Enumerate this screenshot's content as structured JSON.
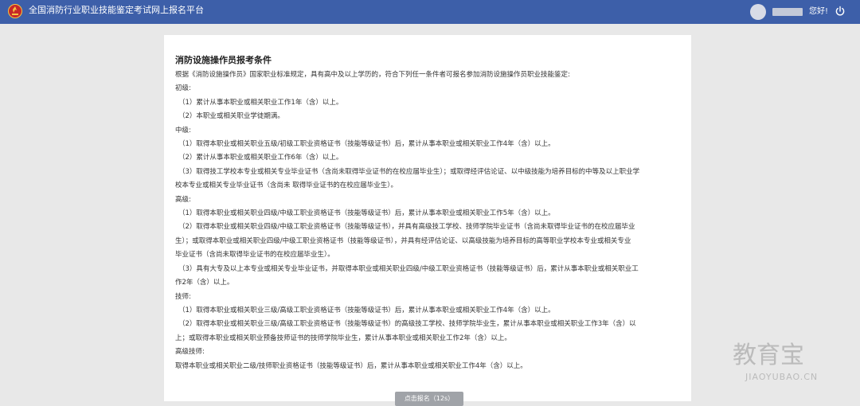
{
  "header": {
    "title": "全国消防行业职业技能鉴定考试网上报名平台",
    "greeting": "您好!",
    "logo_icon": "fire-emblem-icon",
    "power_icon": "power-icon"
  },
  "article": {
    "title": "消防设施操作员报考条件",
    "intro": "根据《消防设施操作员》国家职业标准规定，具有高中及以上学历的，符合下列任一条件者可报名参加消防设施操作员职业技能鉴定:",
    "lines": [
      {
        "text": "初级:",
        "indent": false
      },
      {
        "text": "（1）累计从事本职业或相关职业工作1年（含）以上。",
        "indent": true
      },
      {
        "text": "（2）本职业或相关职业学徒期满。",
        "indent": true
      },
      {
        "text": "中级:",
        "indent": false
      },
      {
        "text": "（1）取得本职业或相关职业五级/初级工职业资格证书（技能等级证书）后，累计从事本职业或相关职业工作4年（含）以上。",
        "indent": true
      },
      {
        "text": "（2）累计从事本职业或相关职业工作6年（含）以上。",
        "indent": true
      },
      {
        "text": "（3）取得技工学校本专业或相关专业毕业证书（含尚未取得毕业证书的在校应届毕业生）；或取得经评估论证、以中级技能为培养目标的中等及以上职业学",
        "indent": true
      },
      {
        "text": "校本专业或相关专业毕业证书（含尚未 取得毕业证书的在校应届毕业生）。",
        "indent": false
      },
      {
        "text": "高级:",
        "indent": false
      },
      {
        "text": "（1）取得本职业或相关职业四级/中级工职业资格证书（技能等级证书）后，累计从事本职业或相关职业工作5年（含）以上。",
        "indent": true
      },
      {
        "text": "（2）取得本职业或相关职业四级/中级工职业资格证书（技能等级证书），并具有高级技工学校、技师学院毕业证书（含尚未取得毕业证书的在校应届毕业",
        "indent": true
      },
      {
        "text": "生）；或取得本职业或相关职业四级/中级工职业资格证书（技能等级证书），并具有经评估论证、以高级技能为培养目标的高等职业学校本专业或相关专业",
        "indent": false
      },
      {
        "text": "毕业证书（含尚未取得毕业证书的在校应届毕业生）。",
        "indent": false
      },
      {
        "text": "（3）具有大专及以上本专业或相关专业毕业证书，并取得本职业或相关职业四级/中级工职业资格证书（技能等级证书）后，累计从事本职业或相关职业工",
        "indent": true
      },
      {
        "text": "作2年（含）以上。",
        "indent": false
      },
      {
        "text": "技师:",
        "indent": false
      },
      {
        "text": "（1）取得本职业或相关职业三级/高级工职业资格证书（技能等级证书）后，累计从事本职业或相关职业工作4年（含）以上。",
        "indent": true
      },
      {
        "text": "（2）取得本职业或相关职业三级/高级工职业资格证书（技能等级证书）的高级技工学校、技师学院毕业生，累计从事本职业或相关职业工作3年（含）以",
        "indent": true
      },
      {
        "text": "上；或取得本职业或相关职业预备技师证书的技师学院毕业生，累计从事本职业或相关职业工作2年（含）以上。",
        "indent": false
      },
      {
        "text": "高级技师:",
        "indent": false
      },
      {
        "text": "取得本职业或相关职业二级/技师职业资格证书（技能等级证书）后，累计从事本职业或相关职业工作4年（含）以上。",
        "indent": false
      }
    ]
  },
  "submit_button": {
    "label": "点击报名（12s）"
  },
  "watermark": {
    "main": "教育宝",
    "sub": "JIAOYUBAO.CN"
  },
  "colors": {
    "header_bg": "#3d5fa9",
    "page_bg": "#e8e8e8",
    "button_bg": "#a0a3a8"
  }
}
